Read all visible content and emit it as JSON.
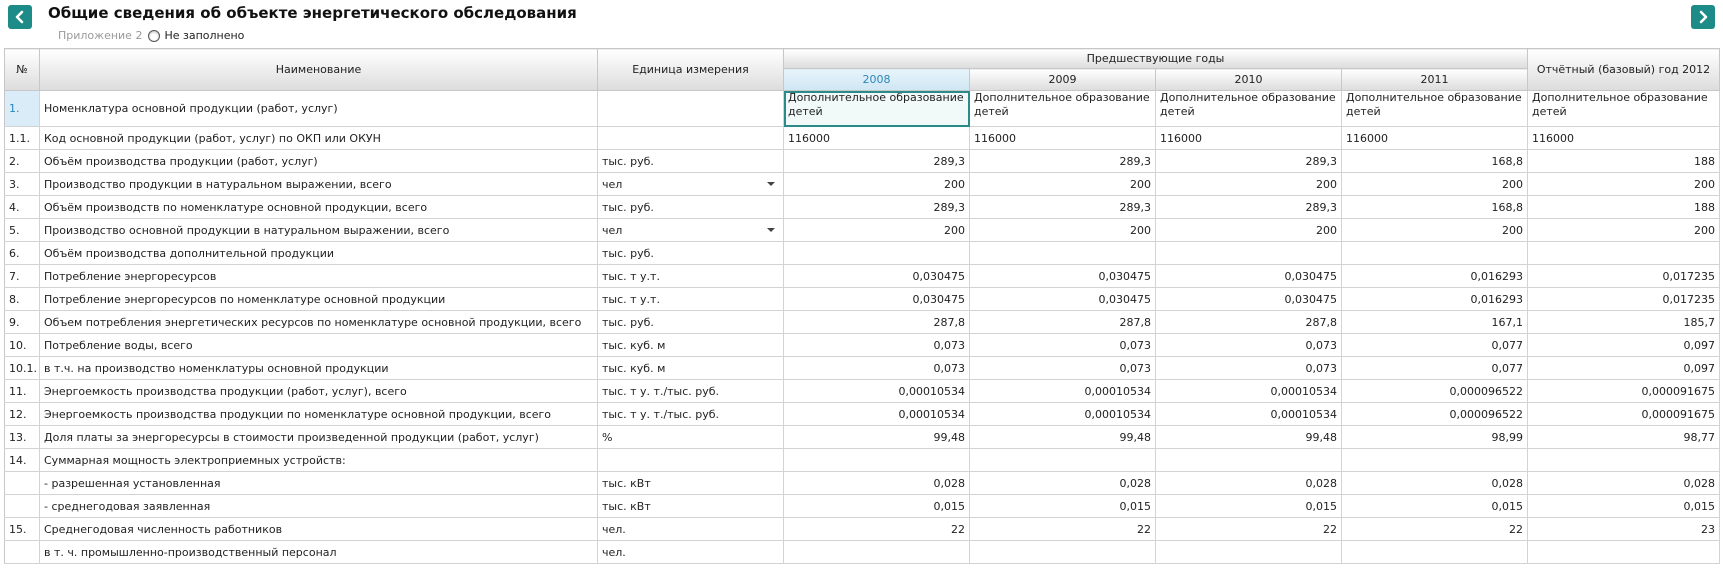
{
  "header": {
    "title": "Общие сведения об объекте энергетического обследования",
    "appendix": "Приложение 2",
    "status": "Не заполнено",
    "prev_icon": "chevron-left-icon",
    "next_icon": "chevron-right-icon"
  },
  "colors": {
    "nav_button": "#1d8c88",
    "selected_year": "#2b87b8"
  },
  "table": {
    "columns": {
      "num": "№",
      "name": "Наименование",
      "unit": "Единица измерения",
      "prev_years": "Предшествующие годы",
      "years": [
        "2008",
        "2009",
        "2010",
        "2011"
      ],
      "report_year": "Отчётный (базовый) год 2012"
    },
    "rows": [
      {
        "num": "1.",
        "name": "Номенклатура основной продукции (работ, услуг)",
        "unit": "",
        "dropdown": false,
        "values": [
          "Дополнительное образование детей",
          "Дополнительное образование детей",
          "Дополнительное образование детей",
          "Дополнительное образование детей",
          "Дополнительное образование детей"
        ],
        "kind": "text"
      },
      {
        "num": "1.1.",
        "name": "Код основной продукции (работ, услуг) по ОКП или ОКУН",
        "unit": "",
        "dropdown": false,
        "values": [
          "116000",
          "116000",
          "116000",
          "116000",
          "116000"
        ],
        "kind": "code"
      },
      {
        "num": "2.",
        "name": "Объём производства продукции (работ, услуг)",
        "unit": "тыс. руб.",
        "dropdown": false,
        "values": [
          "289,3",
          "289,3",
          "289,3",
          "168,8",
          "188"
        ],
        "kind": "num"
      },
      {
        "num": "3.",
        "name": "Производство продукции в натуральном выражении, всего",
        "unit": "чел",
        "dropdown": true,
        "values": [
          "200",
          "200",
          "200",
          "200",
          "200"
        ],
        "kind": "num"
      },
      {
        "num": "4.",
        "name": "Объём производств по номенклатуре основной продукции, всего",
        "unit": "тыс. руб.",
        "dropdown": false,
        "values": [
          "289,3",
          "289,3",
          "289,3",
          "168,8",
          "188"
        ],
        "kind": "num"
      },
      {
        "num": "5.",
        "name": "Производство основной продукции в натуральном выражении, всего",
        "unit": "чел",
        "dropdown": true,
        "values": [
          "200",
          "200",
          "200",
          "200",
          "200"
        ],
        "kind": "num"
      },
      {
        "num": "6.",
        "name": "Объём производства дополнительной продукции",
        "unit": "тыс. руб.",
        "dropdown": false,
        "values": [
          "",
          "",
          "",
          "",
          ""
        ],
        "kind": "num"
      },
      {
        "num": "7.",
        "name": "Потребление энергоресурсов",
        "unit": "тыс. т у.т.",
        "dropdown": false,
        "values": [
          "0,030475",
          "0,030475",
          "0,030475",
          "0,016293",
          "0,017235"
        ],
        "kind": "num"
      },
      {
        "num": "8.",
        "name": "Потребление энергоресурсов по номенклатуре основной продукции",
        "unit": "тыс. т у.т.",
        "dropdown": false,
        "values": [
          "0,030475",
          "0,030475",
          "0,030475",
          "0,016293",
          "0,017235"
        ],
        "kind": "num"
      },
      {
        "num": "9.",
        "name": "Объем потребления энергетических ресурсов по номенклатуре основной продукции, всего",
        "unit": "тыс. руб.",
        "dropdown": false,
        "values": [
          "287,8",
          "287,8",
          "287,8",
          "167,1",
          "185,7"
        ],
        "kind": "num"
      },
      {
        "num": "10.",
        "name": "Потребление воды, всего",
        "unit": "тыс. куб. м",
        "dropdown": false,
        "values": [
          "0,073",
          "0,073",
          "0,073",
          "0,077",
          "0,097"
        ],
        "kind": "num"
      },
      {
        "num": "10.1.",
        "name": "в т.ч. на производство номенклатуры основной продукции",
        "unit": "тыс. куб. м",
        "dropdown": false,
        "values": [
          "0,073",
          "0,073",
          "0,073",
          "0,077",
          "0,097"
        ],
        "kind": "num"
      },
      {
        "num": "11.",
        "name": "Энергоемкость производства продукции (работ, услуг), всего",
        "unit": "тыс. т у. т./тыс. руб.",
        "dropdown": false,
        "values": [
          "0,00010534",
          "0,00010534",
          "0,00010534",
          "0,000096522",
          "0,000091675"
        ],
        "kind": "num"
      },
      {
        "num": "12.",
        "name": "Энергоемкость производства продукции по номенклатуре основной продукции, всего",
        "unit": "тыс. т у. т./тыс. руб.",
        "dropdown": false,
        "values": [
          "0,00010534",
          "0,00010534",
          "0,00010534",
          "0,000096522",
          "0,000091675"
        ],
        "kind": "num"
      },
      {
        "num": "13.",
        "name": "Доля платы за энергоресурсы в стоимости произведенной продукции (работ, услуг)",
        "unit": "%",
        "dropdown": false,
        "values": [
          "99,48",
          "99,48",
          "99,48",
          "98,99",
          "98,77"
        ],
        "kind": "num"
      },
      {
        "num": "14.",
        "name": "Суммарная мощность электроприемных устройств:",
        "unit": "",
        "dropdown": false,
        "values": [
          "",
          "",
          "",
          "",
          ""
        ],
        "kind": "num"
      },
      {
        "num": "",
        "name": "- разрешенная установленная",
        "unit": "тыс. кВт",
        "dropdown": false,
        "values": [
          "0,028",
          "0,028",
          "0,028",
          "0,028",
          "0,028"
        ],
        "kind": "num"
      },
      {
        "num": "",
        "name": "- среднегодовая заявленная",
        "unit": "тыс. кВт",
        "dropdown": false,
        "values": [
          "0,015",
          "0,015",
          "0,015",
          "0,015",
          "0,015"
        ],
        "kind": "num"
      },
      {
        "num": "15.",
        "name": "Среднегодовая численность работников",
        "unit": "чел.",
        "dropdown": false,
        "values": [
          "22",
          "22",
          "22",
          "22",
          "23"
        ],
        "kind": "num"
      },
      {
        "num": "",
        "name": "в т. ч. промышленно-производственный персонал",
        "unit": "чел.",
        "dropdown": false,
        "values": [
          "",
          "",
          "",
          "",
          ""
        ],
        "kind": "num"
      }
    ]
  }
}
